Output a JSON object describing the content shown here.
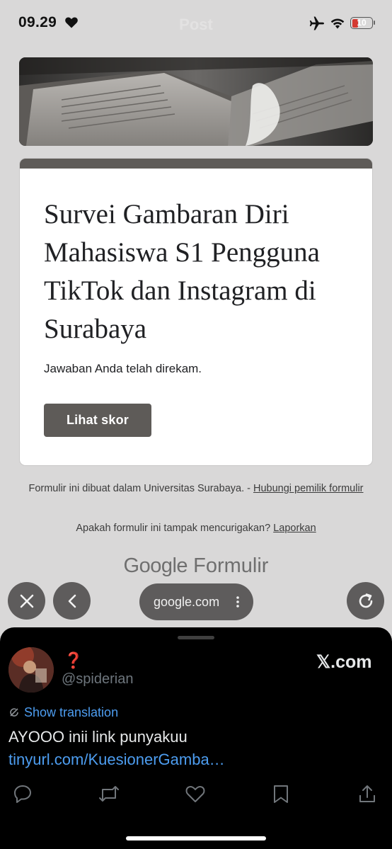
{
  "status_bar": {
    "time": "09.29",
    "center_title": "Post",
    "battery": "10",
    "battery_level": 0.1
  },
  "form": {
    "title": "Survei Gambaran Diri Mahasiswa S1 Pengguna TikTok dan Instagram di Surabaya",
    "confirmation": "Jawaban Anda telah direkam.",
    "score_button": "Lihat skor"
  },
  "footer": {
    "created_in": "Formulir ini dibuat dalam Universitas Surabaya. - ",
    "contact_owner": "Hubungi pemilik formulir",
    "suspicious": "Apakah formulir ini tampak mencurigakan? ",
    "report": "Laporkan",
    "logo_google": "Google",
    "logo_forms": "Formulir"
  },
  "browser": {
    "url": "google.com",
    "close_icon": "close-icon",
    "back_icon": "chevron-left-icon",
    "reload_icon": "reload-icon"
  },
  "tweet": {
    "display_name": "❓",
    "handle": "@spiderian",
    "site": "𝕏.com",
    "translate": "Show translation",
    "text": "AYOOO inii link punyakuu ",
    "link": "tinyurl.com/KuesionerGamba…",
    "actions": [
      "reply-icon",
      "repost-icon",
      "like-icon",
      "bookmark-icon",
      "share-icon"
    ]
  },
  "colors": {
    "background": "#d9d8d8",
    "form_accent": "#5e5b58",
    "link_blue": "#4d9df0",
    "sheet": "#000000"
  }
}
